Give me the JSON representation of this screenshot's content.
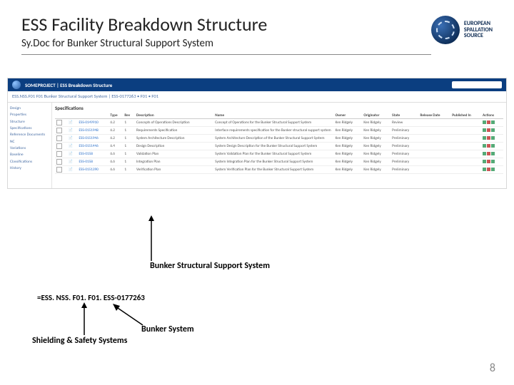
{
  "header": {
    "title": "ESS Facility Breakdown Structure",
    "subtitle": "Sy.Doc for Bunker Structural Support System",
    "logo_label_l1": "EUROPEAN",
    "logo_label_l2": "SPALLATION",
    "logo_label_l3": "SOURCE"
  },
  "app": {
    "bar_title": "SOMEPROJECT | ESS Breakdown Structure",
    "search_placeholder": "",
    "breadcrumb": "ESS.NSS.F01  F01  Bunker Structural Support System   |  ESS-0177263 • F01 • F01",
    "sidebar": [
      "Design",
      "Properties",
      "Structure",
      "Specifications",
      "Reference Documents",
      "NC",
      "Variations",
      "Baseline",
      "Classifications",
      "History"
    ],
    "panel_title": "Specifications",
    "columns": [
      "",
      "",
      "",
      "Type",
      "Rev",
      "Description",
      "Name",
      "Owner",
      "Originator",
      "State",
      "Release Date",
      "Published In",
      "Actions"
    ],
    "rows": [
      {
        "id": "ESS-0149910",
        "type": "6.2",
        "rev": "Concepts of Operations Description",
        "name": "Concept of Operations for the Bunker Structural Support System",
        "desc": "Concept of Operations for the Bunker Structural Support System",
        "owner": "Ken Ridgely",
        "orig": "Ken Ridgely",
        "state": "Review"
      },
      {
        "id": "ESS-0151948",
        "type": "6.2",
        "rev": "Requirements Specification",
        "name": "Interface requirements specification for the Bunker structural support system",
        "desc": "Interface requirements specification for the Bunker structural support system",
        "owner": "Ken Ridgely",
        "orig": "Ken Ridgely",
        "state": "Preliminary"
      },
      {
        "id": "ESS-0151946",
        "type": "6.2",
        "rev": "System Architecture Description",
        "name": "System Architecture Description of the Bunker Structural Support System",
        "desc": "System Architecture Description of the Bunker Structural Support System",
        "owner": "Ken Ridgely",
        "orig": "Ken Ridgely",
        "state": "Preliminary"
      },
      {
        "id": "ESS-0151446",
        "type": "6.4",
        "rev": "Design Description",
        "name": "System Design Description for the Bunker Structural Support System",
        "desc": "System Design Description for the Bunker Structural Support System",
        "owner": "Ken Ridgely",
        "orig": "Ken Ridgely",
        "state": "Preliminary"
      },
      {
        "id": "ESS-0158",
        "type": "6.6",
        "rev": "Validation Plan",
        "name": "System Validation Plan for the Bunker Structural Support System",
        "desc": "System Validation Plan for the Bunker Structural Support System",
        "owner": "Ken Ridgely",
        "orig": "Ken Ridgely",
        "state": "Preliminary"
      },
      {
        "id": "ESS-0158",
        "type": "6.6",
        "rev": "Integration Plan",
        "name": "System Integration Plan for the Bunker Structural Support System",
        "desc": "System Integration Plan for the Bunker Structural Support System",
        "owner": "Ken Ridgely",
        "orig": "Ken Ridgely",
        "state": "Preliminary"
      },
      {
        "id": "ESS-0151390",
        "type": "6.6",
        "rev": "Verification Plan",
        "name": "System Verification Plan for the Bunker Structural Support System",
        "desc": "System Verification Plan for the Bunker Structural Support System",
        "owner": "Ken Ridgely",
        "orig": "Ken Ridgely",
        "state": "Preliminary"
      }
    ]
  },
  "annotations": {
    "bss": "Bunker Structural Support System",
    "code": "=ESS. NSS. F01. F01. ESS-0177263",
    "bs": "Bunker System",
    "sss": "Shielding & Safety Systems"
  },
  "page_number": "8"
}
